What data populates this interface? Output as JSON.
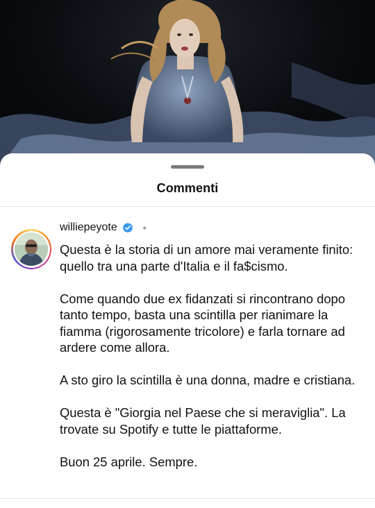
{
  "sheet": {
    "title": "Commenti"
  },
  "comment": {
    "username": "williepeyote",
    "verified": true,
    "separator": "•",
    "text": "Questa è la storia di un amore mai veramente finito: quello tra una parte d'Italia e il fa$cismo.\n\nCome quando due ex fidanzati si rincontrano dopo tanto tempo, basta una scintilla per rianimare la fiamma (rigorosamente tricolore) e farla tornare ad ardere come allora.\n\nA sto giro la scintilla è una donna, madre e cristiana.\n\nQuesta è \"Giorgia nel Paese che si meraviglia\". La trovate su Spotify e tutte le piattaforme.\n\nBuon 25 aprile. Sempre."
  },
  "colors": {
    "verified_badge": "#3897f0",
    "avatar_ring": [
      "#feda75",
      "#fa7e1e",
      "#d62976",
      "#962fbf",
      "#4f5bd5"
    ]
  }
}
